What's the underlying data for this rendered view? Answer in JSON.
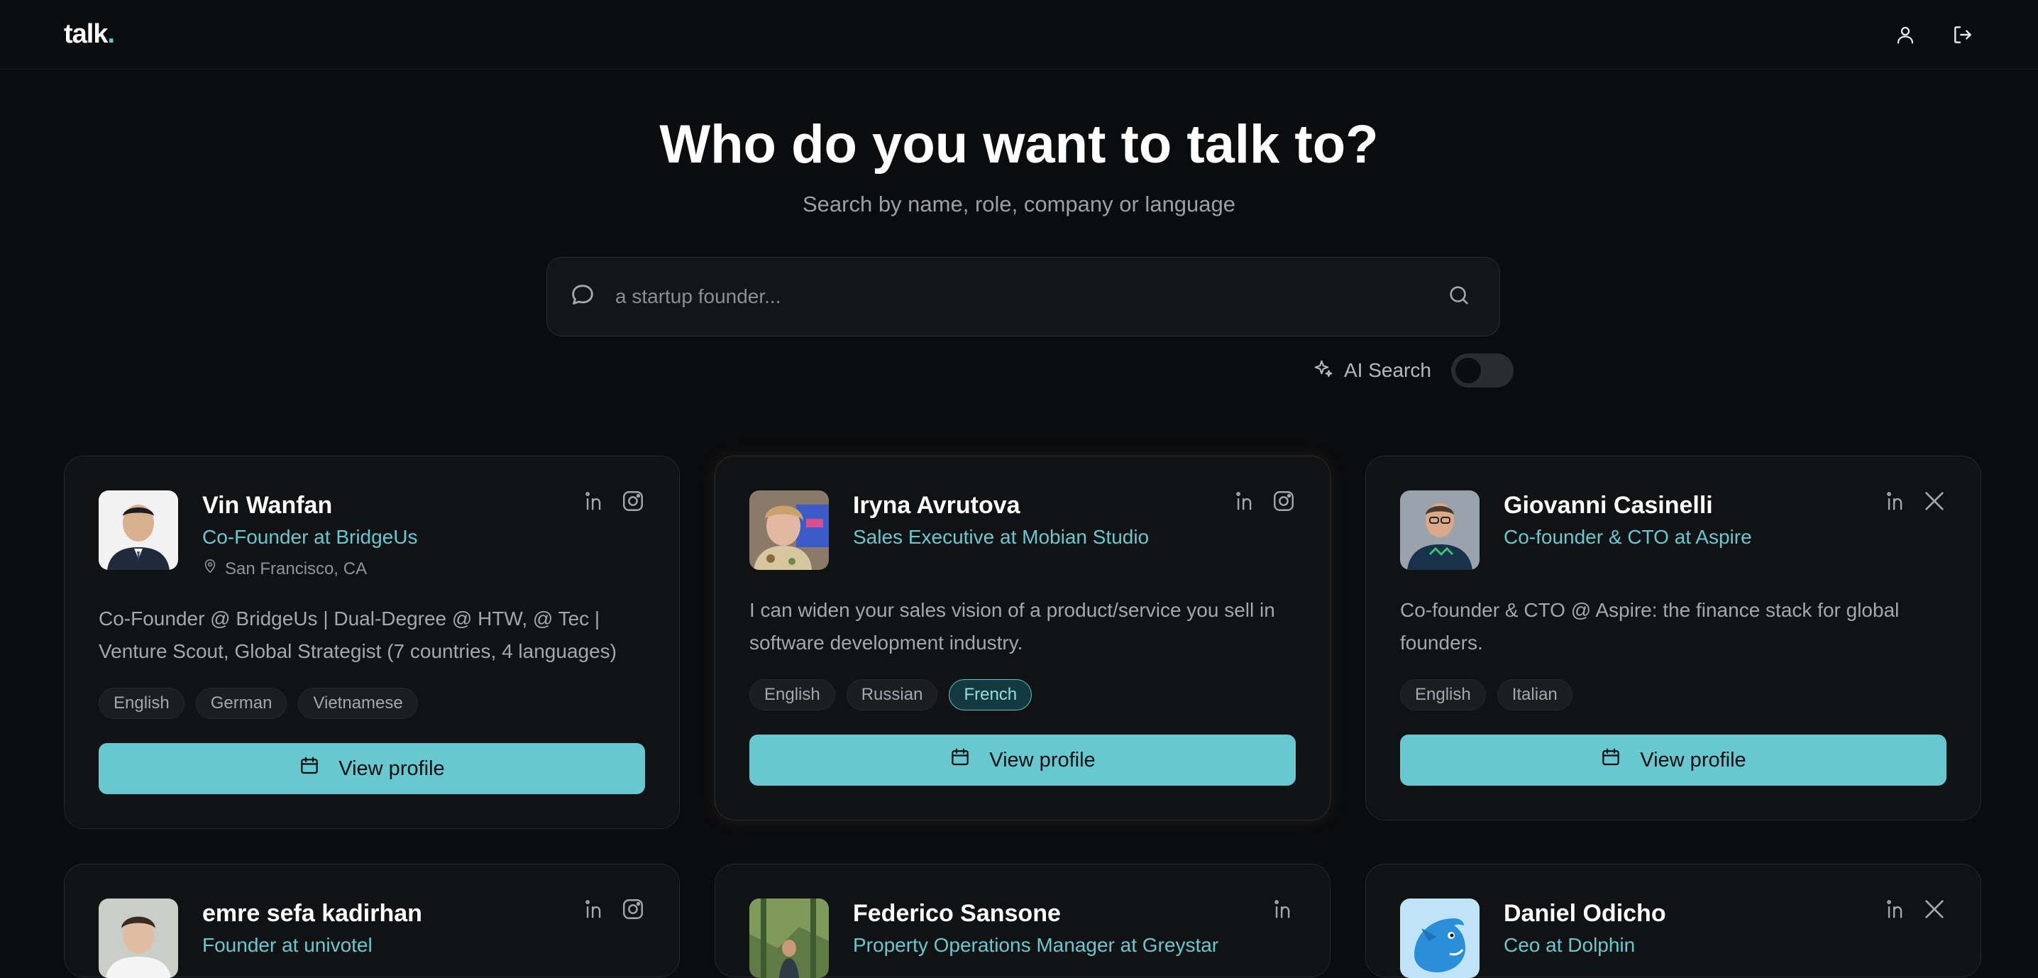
{
  "brand": {
    "name": "talk",
    "dot": "."
  },
  "header": {
    "icons": [
      "user-icon",
      "logout-icon"
    ]
  },
  "hero": {
    "title": "Who do you want to talk to?",
    "subtitle": "Search by name, role, company or language"
  },
  "search": {
    "placeholder": "a startup founder...",
    "value": ""
  },
  "ai_search": {
    "label": "AI Search",
    "enabled": false
  },
  "colors": {
    "accent": "#67c8d0",
    "background": "#0b0c0e",
    "card": "#111214"
  },
  "cards": [
    {
      "name": "Vin Wanfan",
      "role": "Co-Founder at BridgeUs",
      "location": "San Francisco, CA",
      "bio": "Co-Founder @ BridgeUs | Dual-Degree @ HTW, @ Tec | Venture Scout, Global Strategist (7 countries, 4 languages)",
      "languages": [
        "English",
        "German",
        "Vietnamese"
      ],
      "socials": [
        "linkedin-icon",
        "instagram-icon"
      ],
      "button": "View profile"
    },
    {
      "name": "Iryna Avrutova",
      "role": "Sales Executive at Mobian Studio",
      "bio": "I can widen your sales vision of a product/service you sell in software development industry.",
      "languages": [
        "English",
        "Russian",
        "French"
      ],
      "highlighted_language": "French",
      "socials": [
        "linkedin-icon",
        "instagram-icon"
      ],
      "button": "View profile"
    },
    {
      "name": "Giovanni Casinelli",
      "role": "Co-founder & CTO at Aspire",
      "bio": "Co-founder & CTO @ Aspire: the finance stack for global founders.",
      "languages": [
        "English",
        "Italian"
      ],
      "socials": [
        "linkedin-icon",
        "x-icon"
      ],
      "button": "View profile"
    },
    {
      "name": "emre sefa kadirhan",
      "role": "Founder at univotel",
      "socials": [
        "linkedin-icon",
        "instagram-icon"
      ]
    },
    {
      "name": "Federico Sansone",
      "role": "Property Operations Manager at Greystar",
      "socials": [
        "linkedin-icon"
      ]
    },
    {
      "name": "Daniel Odicho",
      "role": "Ceo at Dolphin",
      "socials": [
        "linkedin-icon",
        "x-icon"
      ]
    }
  ]
}
